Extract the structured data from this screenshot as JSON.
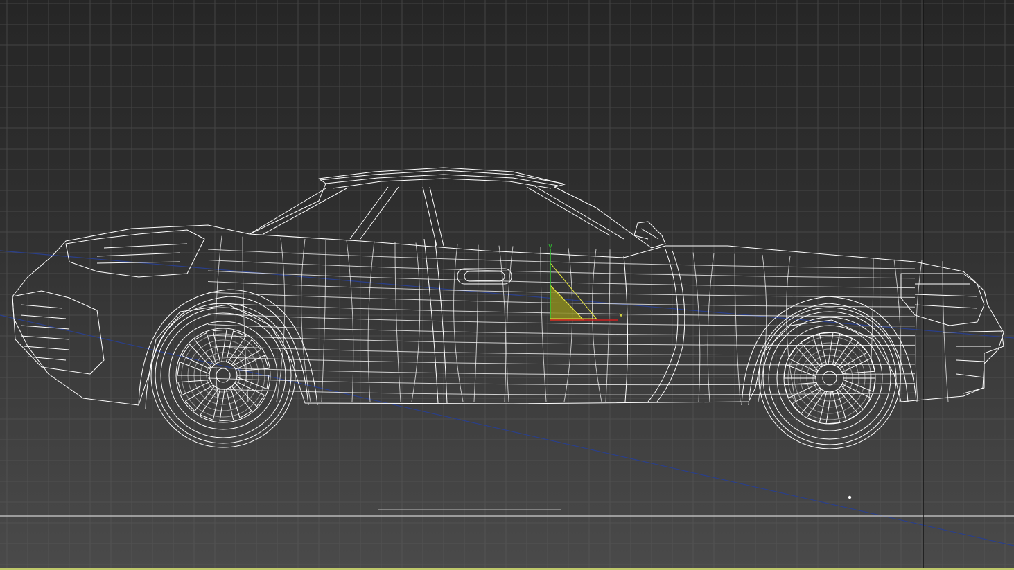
{
  "viewport": {
    "view": "orthographic-side",
    "display_mode": "wireframe",
    "background_top": "#262626",
    "background_bottom": "#4a4a4a",
    "grid_color": "#5a5a5a",
    "wire_color": "#ffffff",
    "selection_color": "#e8e840"
  },
  "gizmo": {
    "x_label": "x",
    "y_label": "y",
    "x_axis_color": "#d02020",
    "y_axis_color": "#30c030",
    "plane_color": "#d8d820"
  },
  "scene_object": {
    "name_icon": "car-wireframe-icon"
  }
}
